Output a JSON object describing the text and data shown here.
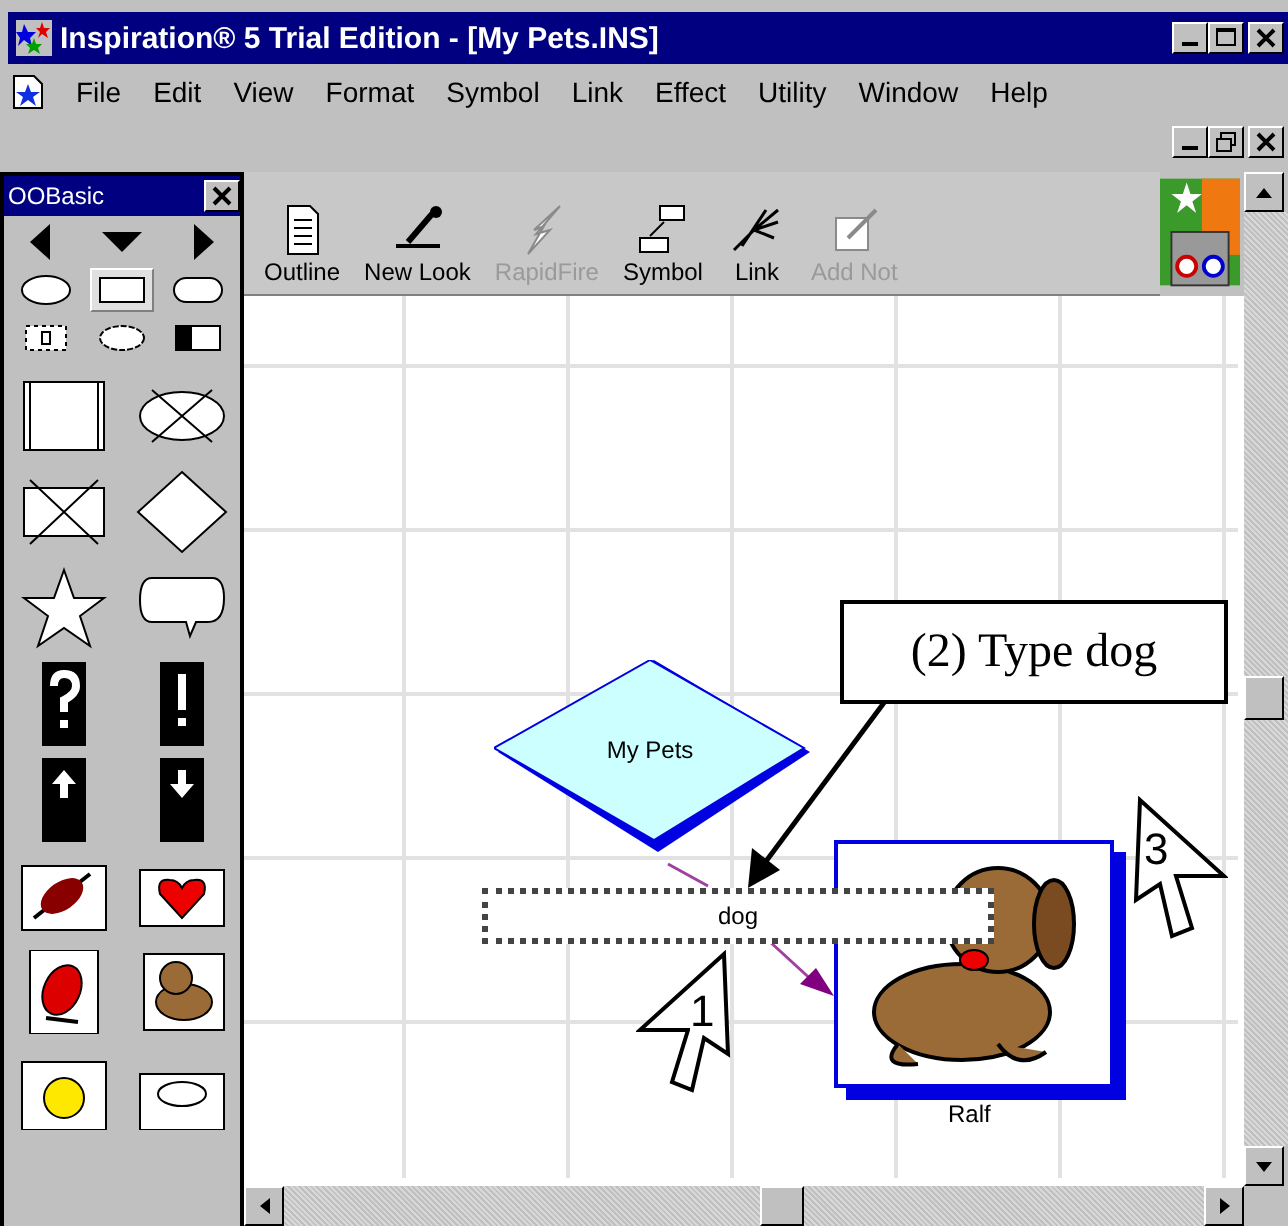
{
  "window": {
    "title": "Inspiration® 5 Trial Edition - [My Pets.INS]"
  },
  "menu": [
    "File",
    "Edit",
    "View",
    "Format",
    "Symbol",
    "Link",
    "Effect",
    "Utility",
    "Window",
    "Help"
  ],
  "palette": {
    "title": "OOBasic",
    "small_shapes": [
      {
        "kind": "oval",
        "selected": false
      },
      {
        "kind": "rectangle",
        "selected": true
      },
      {
        "kind": "rounded",
        "selected": false
      },
      {
        "kind": "label",
        "selected": false
      },
      {
        "kind": "cloud",
        "selected": false
      },
      {
        "kind": "half",
        "selected": false
      }
    ],
    "shapes": [
      {
        "kind": "double-rect",
        "selected": false
      },
      {
        "kind": "crossed-oval",
        "selected": false
      },
      {
        "kind": "crossed-rect",
        "selected": false
      },
      {
        "kind": "diamond",
        "selected": false
      },
      {
        "kind": "star",
        "selected": false
      },
      {
        "kind": "bubble",
        "selected": false
      },
      {
        "kind": "question",
        "selected": false
      },
      {
        "kind": "exclaim",
        "selected": false
      },
      {
        "kind": "up",
        "selected": false
      },
      {
        "kind": "down",
        "selected": false
      },
      {
        "kind": "leaf",
        "selected": false
      },
      {
        "kind": "heart",
        "selected": false
      },
      {
        "kind": "bird",
        "selected": false
      },
      {
        "kind": "dog",
        "selected": false
      },
      {
        "kind": "sun",
        "selected": false
      },
      {
        "kind": "cloud",
        "selected": false
      }
    ]
  },
  "toolbar": [
    {
      "label": "Outline",
      "kind": "outline",
      "disabled": false
    },
    {
      "label": "New Look",
      "kind": "look",
      "disabled": false
    },
    {
      "label": "RapidFire",
      "kind": "rapid",
      "disabled": true
    },
    {
      "label": "Symbol",
      "kind": "symbol",
      "disabled": false
    },
    {
      "label": "Link",
      "kind": "link",
      "disabled": false
    },
    {
      "label": "Add Not",
      "kind": "note",
      "disabled": true
    }
  ],
  "canvas": {
    "nodes": [
      {
        "kind": "topic",
        "label": "My Pets"
      },
      {
        "kind": "editing",
        "value": "dog"
      },
      {
        "kind": "picture-symbol",
        "label": "Ralf"
      }
    ]
  },
  "annotations": {
    "callout": "(2) Type dog",
    "cursors": [
      {
        "label": "1",
        "kind": "mirrored"
      },
      {
        "label": "3",
        "kind": "normal"
      }
    ]
  }
}
